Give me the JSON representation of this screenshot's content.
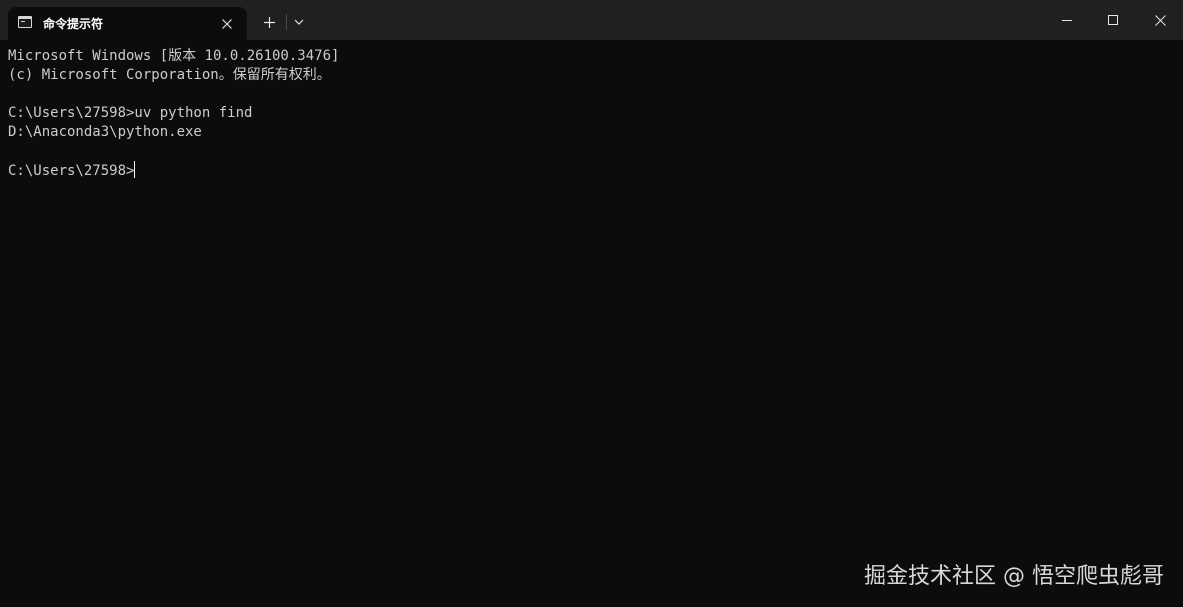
{
  "window": {
    "tab_title": "命令提示符",
    "tab_icon": "cmd-terminal-icon",
    "tab_close_icon": "close-icon",
    "new_tab_icon": "plus-icon",
    "dropdown_icon": "chevron-down-icon",
    "controls": [
      "minimize-icon",
      "maximize-icon",
      "close-icon"
    ]
  },
  "terminal": {
    "lines": [
      "Microsoft Windows [版本 10.0.26100.3476]",
      "(c) Microsoft Corporation。保留所有权利。",
      "",
      "C:\\Users\\27598>uv python find",
      "D:\\Anaconda3\\python.exe",
      "",
      "C:\\Users\\27598>"
    ],
    "colors": {
      "background": "#0c0c0c",
      "text": "#cccccc",
      "titlebar": "#202020"
    }
  },
  "watermark": {
    "text": "掘金技术社区 @ 悟空爬虫彪哥"
  }
}
